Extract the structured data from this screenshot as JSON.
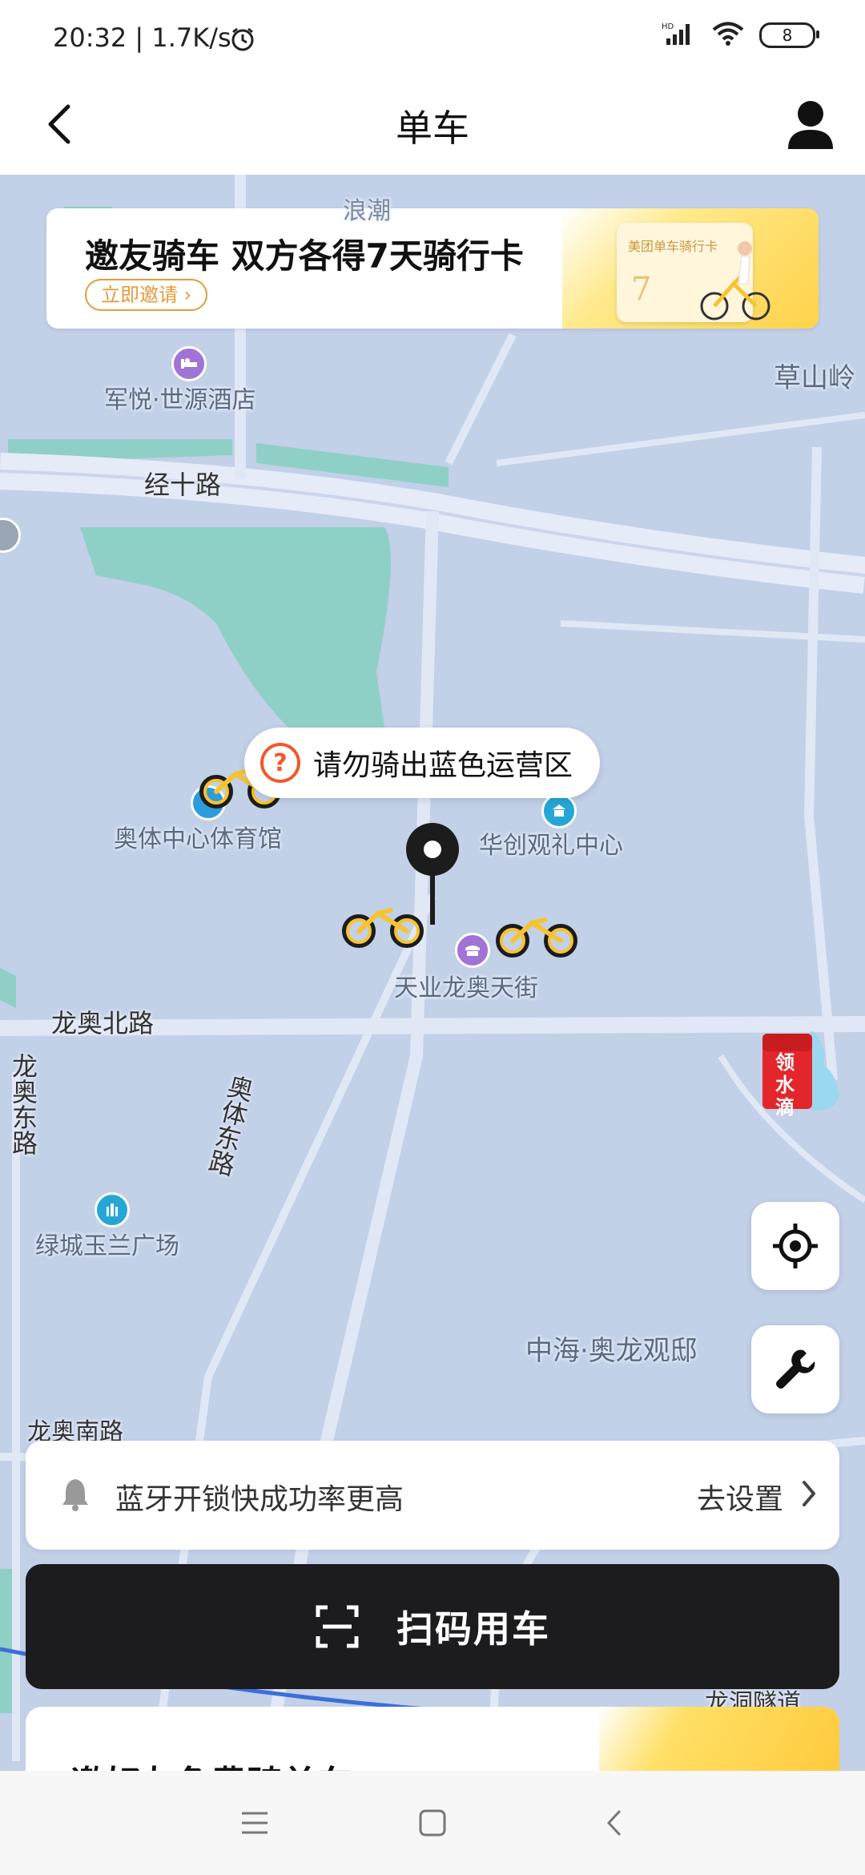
{
  "status_bar": {
    "time": "20:32 | 1.7K/s",
    "battery": "8",
    "icons": [
      "alarm-icon",
      "hd-signal-icon",
      "wifi-icon",
      "battery-icon"
    ]
  },
  "header": {
    "title": "单车",
    "back_icon": "chevron-left-icon",
    "profile_icon": "user-icon"
  },
  "invite_banner": {
    "title": "邀友骑车 双方各得7天骑行卡",
    "button": "立即邀请 ›",
    "card_text": "美团单车骑行卡",
    "card_number": "7"
  },
  "map": {
    "labels": {
      "hotel": "军悦·世源酒店",
      "caoshanling": "草山岭",
      "jingshilu": "经十路",
      "stadium": "奥体中心体育馆",
      "huachuang": "华创观礼中心",
      "tianye": "天业龙奥天街",
      "longaobeilu": "龙奥北路",
      "longaodonglu": "龙奥东路",
      "aotidonglu": "奥体东路",
      "lvcheng": "绿城玉兰广场",
      "zhonghai": "中海·奥龙观邸",
      "longaonanlu": "龙奥南路",
      "top_partial": "浪潮",
      "tunnel": "龙洞隧道"
    },
    "tooltip": "请勿骑出蓝色运营区",
    "redpacket_label": "领水滴",
    "colors": {
      "operating_area": "#c2d0e8",
      "water": "#8fd0c6",
      "bike_yellow": "#f6c431"
    }
  },
  "bluetooth": {
    "text": "蓝牙开锁快成功率更高",
    "action": "去设置"
  },
  "scan": {
    "label": "扫码用车"
  },
  "promo": {
    "title": "邀好友免费骑单车"
  }
}
